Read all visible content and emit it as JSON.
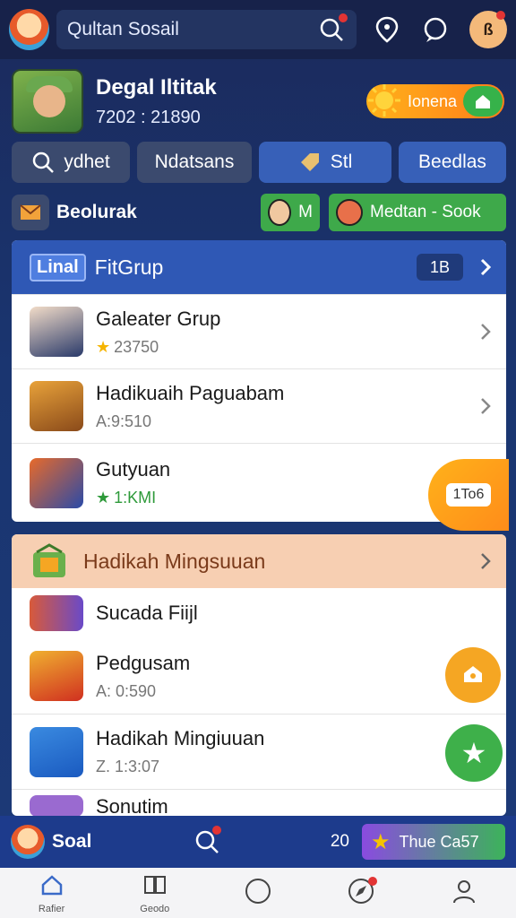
{
  "header": {
    "search_label": "Qultan Sosail",
    "avatar_text": "ß"
  },
  "profile": {
    "name": "Degal Iltitak",
    "score": "7202 : 21890",
    "badge_label": "Ionena"
  },
  "pills": [
    "ydhet",
    "Ndatsans",
    "Stl",
    "Beedlas"
  ],
  "row2": {
    "label": "Beolurak",
    "chip1": "M",
    "chip2": "Medtan - Sook"
  },
  "card1": {
    "tag": "Linal",
    "title": "FitGrup",
    "count": "1B",
    "items": [
      {
        "title": "Galeater Grup",
        "sub": "23750"
      },
      {
        "title": "Hadikuaih Paguabam",
        "sub": "A:9:510"
      },
      {
        "title": "Gutyuan",
        "sub": "1:KMI"
      }
    ],
    "fab_label": "1To6"
  },
  "card2": {
    "title": "Hadikah Mingsuuan",
    "items": [
      {
        "title": "Sucada Fiijl",
        "sub": ""
      },
      {
        "title": "Pedgusam",
        "sub": "A: 0:590"
      },
      {
        "title": "Hadikah Mingiuuan",
        "sub": "Z. 1:3:07"
      },
      {
        "title": "Sonutim",
        "sub": ""
      }
    ]
  },
  "bottom": {
    "label": "Soal",
    "count": "20",
    "pill": "Thue Ca57"
  },
  "nav": [
    "Rafier",
    "Geodo",
    "",
    "",
    ""
  ],
  "colors": {
    "accent": "#2f58b5",
    "orange": "#ff9d1a",
    "green": "#3ea94a"
  }
}
